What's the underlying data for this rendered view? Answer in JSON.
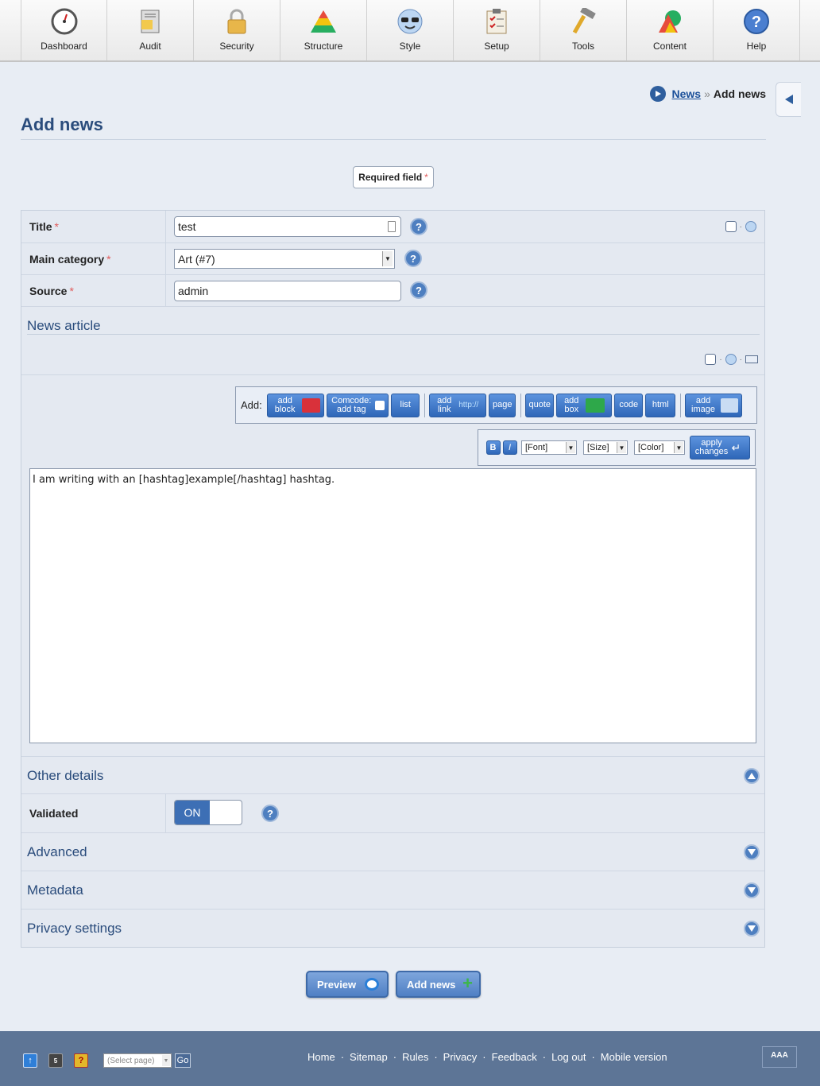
{
  "nav": {
    "items": [
      {
        "label": "Dashboard",
        "icon": "dashboard-gauge-icon"
      },
      {
        "label": "Audit",
        "icon": "audit-document-icon"
      },
      {
        "label": "Security",
        "icon": "padlock-icon"
      },
      {
        "label": "Structure",
        "icon": "pyramid-icon"
      },
      {
        "label": "Style",
        "icon": "sunglasses-face-icon"
      },
      {
        "label": "Setup",
        "icon": "clipboard-checklist-icon"
      },
      {
        "label": "Tools",
        "icon": "hammer-icon"
      },
      {
        "label": "Content",
        "icon": "shapes-icon"
      },
      {
        "label": "Help",
        "icon": "question-icon"
      }
    ]
  },
  "breadcrumb": {
    "link": "News",
    "separator": "»",
    "current": "Add news"
  },
  "page": {
    "title": "Add news"
  },
  "required_field": {
    "label": "Required field",
    "marker": "*"
  },
  "form": {
    "title": {
      "label": "Title",
      "value": "test"
    },
    "main_category": {
      "label": "Main category",
      "value": "Art (#7)"
    },
    "source": {
      "label": "Source",
      "value": "admin"
    },
    "news_article": {
      "heading": "News article",
      "add_label": "Add:",
      "buttons": {
        "add_block": "add block",
        "comcode_tag": "Comcode: add tag",
        "list": "list",
        "add_link": "add link",
        "link_badge": "http://",
        "page": "page",
        "quote": "quote",
        "add_box": "add box",
        "code": "code",
        "html": "html",
        "add_image": "add image"
      },
      "format": {
        "bold": "B",
        "italic": "I",
        "font": "[Font]",
        "size": "[Size]",
        "color": "[Color]",
        "apply": "apply changes"
      },
      "text": "I am writing with an [hashtag]example[/hashtag] hashtag."
    },
    "other_details": {
      "heading": "Other details"
    },
    "validated": {
      "label": "Validated",
      "state": "ON"
    },
    "advanced": {
      "heading": "Advanced"
    },
    "metadata": {
      "heading": "Metadata"
    },
    "privacy": {
      "heading": "Privacy settings"
    }
  },
  "actions": {
    "preview": "Preview",
    "add_news": "Add news"
  },
  "footer": {
    "select_placeholder": "(Select page)",
    "go": "Go",
    "links": [
      "Home",
      "Sitemap",
      "Rules",
      "Privacy",
      "Feedback",
      "Log out",
      "Mobile version"
    ],
    "separator": "·",
    "font_size_letters": "AAA"
  },
  "colors": {
    "accent": "#3d6fb5",
    "footer": "#5d7596",
    "heading": "#2a4c7c",
    "required": "#e05a5a"
  }
}
